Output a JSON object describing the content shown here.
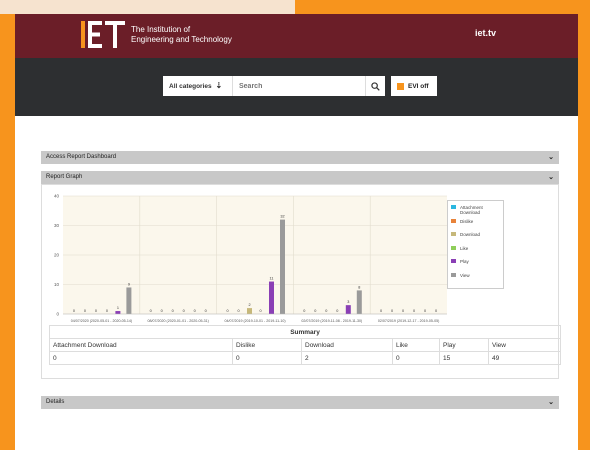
{
  "header": {
    "logo_line1": "The Institution of",
    "logo_line2": "Engineering and Technology",
    "site_link": "iet.tv"
  },
  "search": {
    "category_label": "All categories",
    "placeholder": "Search",
    "evi_label": "EVI off"
  },
  "panels": {
    "dashboard": "Access Report Dashboard",
    "graph": "Report Graph",
    "details": "Details"
  },
  "colors": {
    "header": "#6b1e28",
    "searchbar": "#2d2f31",
    "accent": "#f7941d"
  },
  "chart_data": {
    "type": "bar",
    "categories": [
      "04/07/2020 (2020-05-01 - 2020-05-14)",
      "08/07/2020 (2020-01-01 - 2020-05-31)",
      "04/07/2019 (2019-10-01 - 2019-11-10)",
      "02/07/2019 (2019-11-08 - 2019-11-30)",
      "02/07/2019 (2019-12-17 - 2019-05-05)"
    ],
    "series": [
      {
        "name": "Attachment Download",
        "color": "#2ab7e0",
        "values": [
          0,
          0,
          0,
          0,
          0
        ]
      },
      {
        "name": "Dislike",
        "color": "#e8833a",
        "values": [
          0,
          0,
          0,
          0,
          0
        ]
      },
      {
        "name": "Download",
        "color": "#c6b87a",
        "values": [
          0,
          0,
          2,
          0,
          0
        ]
      },
      {
        "name": "Like",
        "color": "#8fce5a",
        "values": [
          0,
          0,
          0,
          0,
          0
        ]
      },
      {
        "name": "Play",
        "color": "#8a3fb5",
        "values": [
          1,
          0,
          11,
          3,
          0
        ]
      },
      {
        "name": "View",
        "color": "#9a9a9a",
        "values": [
          9,
          0,
          32,
          8,
          0
        ]
      }
    ],
    "ylim": [
      0,
      40
    ],
    "yticks": [
      0,
      10,
      20,
      30,
      40
    ],
    "legend": "right",
    "grid": true
  },
  "summary": {
    "title": "Summary",
    "headers": [
      "Attachment Download",
      "Dislike",
      "Download",
      "Like",
      "Play",
      "View"
    ],
    "values": [
      "0",
      "0",
      "2",
      "0",
      "15",
      "49"
    ]
  }
}
